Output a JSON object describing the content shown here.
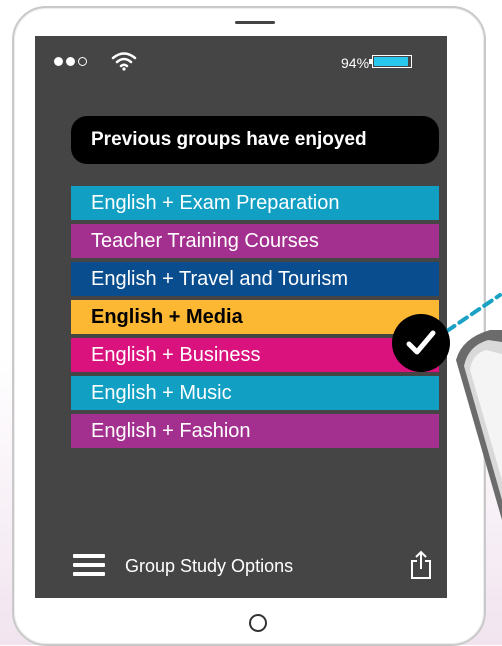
{
  "status_bar": {
    "battery_percent": "94%",
    "battery_level": 0.94,
    "signal_bars": 2,
    "signal_bars_total": 3
  },
  "header": {
    "title": "Previous groups have enjoyed"
  },
  "options": [
    {
      "label": "English + Exam Preparation",
      "color": "#119fc4",
      "selected": false
    },
    {
      "label": "Teacher Training Courses",
      "color": "#a3308e",
      "selected": false
    },
    {
      "label": "English + Travel and Tourism",
      "color": "#0a4d8f",
      "selected": false
    },
    {
      "label": "English + Media",
      "color": "#fcb733",
      "selected": true
    },
    {
      "label": "English + Business",
      "color": "#d9127e",
      "selected": false
    },
    {
      "label": "English + Music",
      "color": "#119fc4",
      "selected": false
    },
    {
      "label": "English + Fashion",
      "color": "#a3308e",
      "selected": false
    }
  ],
  "footer": {
    "menu_icon": "hamburger-icon",
    "label": "Group Study Options",
    "share_icon": "share-icon"
  },
  "badge": {
    "icon": "checkmark-icon"
  },
  "colors": {
    "screen_bg": "#454545",
    "accent_teal": "#29c6ee",
    "dashed_line": "#1aa1c3"
  }
}
